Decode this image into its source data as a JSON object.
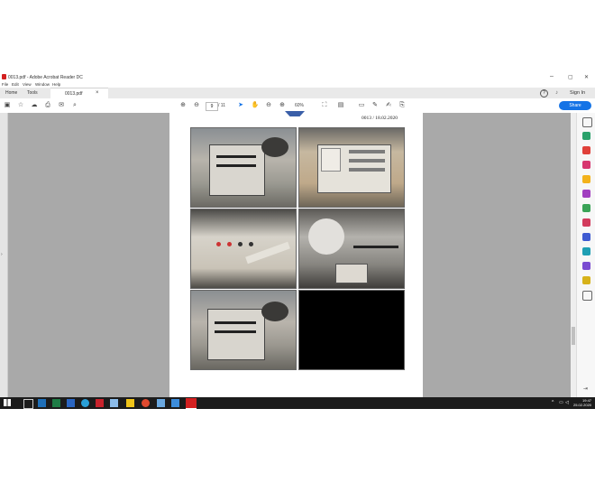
{
  "window": {
    "title": "0013.pdf - Adobe Acrobat Reader DC",
    "menu": [
      "File",
      "Edit",
      "View",
      "Window",
      "Help"
    ],
    "controls": {
      "minimize": "–",
      "maximize": "▢",
      "close": "✕"
    }
  },
  "tabs": {
    "home": "Home",
    "tools": "Tools",
    "file": "0013.pdf",
    "close": "×",
    "sign_in": "Sign In"
  },
  "toolbar": {
    "page_current": "9",
    "page_total": "/ 11",
    "zoom": "60%",
    "share": "Share"
  },
  "document": {
    "header_text": "0013 / 18.02.2020"
  },
  "taskbar": {
    "time": "19:47",
    "date": "25.02.2020"
  },
  "colors": {
    "accent": "#1473e6",
    "acrobat_red": "#d32020",
    "taskbar": "#1c1c1c"
  }
}
